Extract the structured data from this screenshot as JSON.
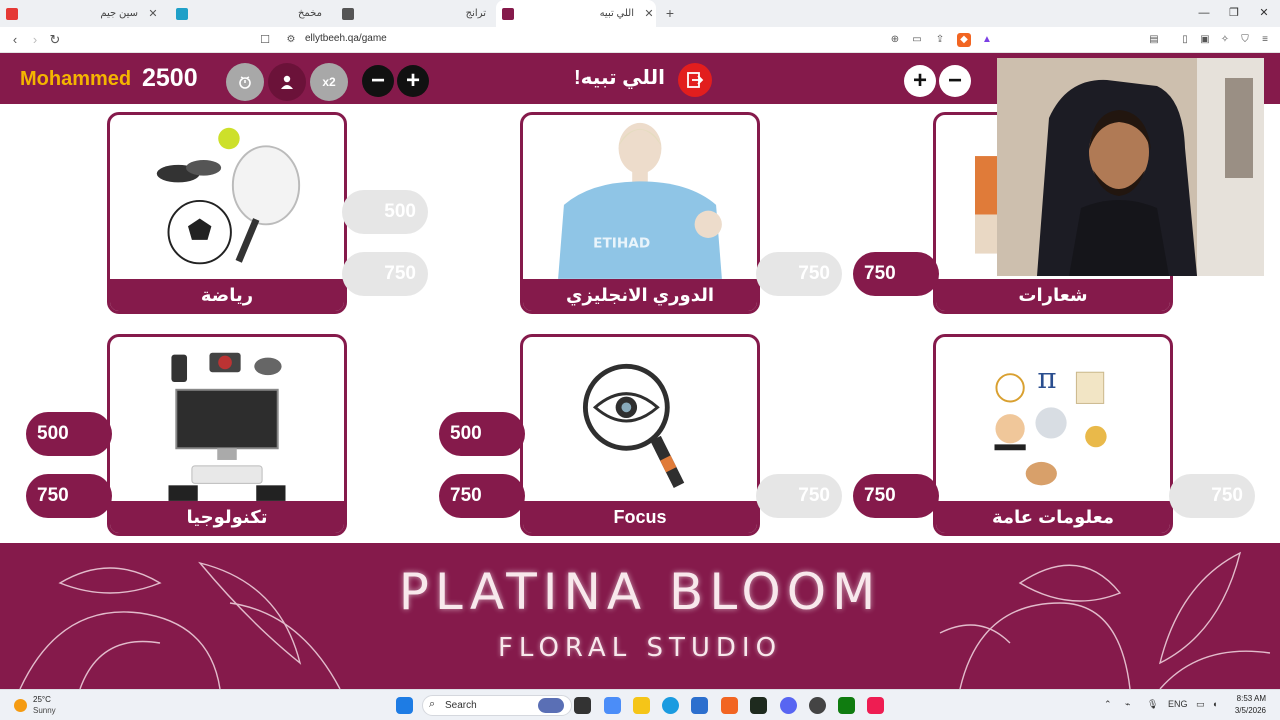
{
  "browser": {
    "tabs": [
      {
        "title": "سين جيم",
        "active": false
      },
      {
        "title": "مخمخ",
        "active": false
      },
      {
        "title": "ترانج",
        "active": false
      },
      {
        "title": "اللي تبيه",
        "active": true
      }
    ],
    "url": "ellytbeeh.qa/game"
  },
  "game": {
    "player_name": "Mohammed",
    "player_score": "2500",
    "double_label": "x2",
    "logo_text": "اللي تبيه!",
    "plus": "+",
    "minus": "−"
  },
  "categories": [
    {
      "label": "رياضة"
    },
    {
      "label": "الدوري الانجليزي"
    },
    {
      "label": "شعارات"
    },
    {
      "label": "تكنولوجيا"
    },
    {
      "label": "Focus"
    },
    {
      "label": "معلومات عامة"
    }
  ],
  "pills": {
    "c1_right_top": "500",
    "c1_right_bottom": "750",
    "c2_right_bottom": "750",
    "c3_left_bottom": "750",
    "c4_left_top": "500",
    "c4_left_bottom": "750",
    "c5_left_top": "500",
    "c5_left_bottom": "750",
    "c5_right_bottom": "750",
    "c6_left_bottom": "750",
    "c6_right_bottom": "750"
  },
  "banner": {
    "title": "PLATINA BLOOM",
    "subtitle": "FLORAL STUDIO"
  },
  "taskbar": {
    "temperature": "25°C",
    "weather": "Sunny",
    "search_label": "Search",
    "lang": "ENG",
    "time": "8:53 AM",
    "date": "3/5/2026"
  },
  "colors": {
    "brand": "#851a4b",
    "accent": "#f4b400",
    "exit": "#e21e1e"
  }
}
